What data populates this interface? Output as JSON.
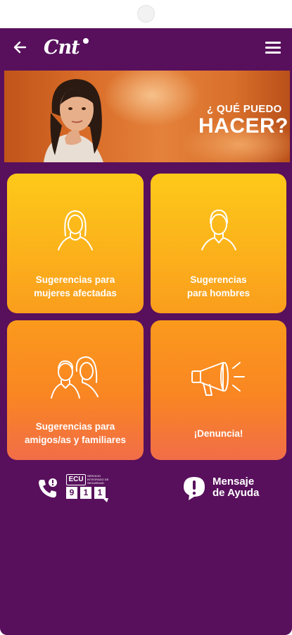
{
  "header": {
    "logo_text": "Cnt",
    "back_icon": "arrow-left-icon",
    "menu_icon": "hamburger-menu-icon"
  },
  "banner": {
    "question_line1": "¿ QUÉ PUEDO",
    "question_line2": "HACER?"
  },
  "cards": [
    {
      "line1": "Sugerencias para",
      "line2": "mujeres afectadas",
      "icon": "woman-icon"
    },
    {
      "line1": "Sugerencias",
      "line2": "para hombres",
      "icon": "man-icon"
    },
    {
      "line1": "Sugerencias para",
      "line2": "amigos/as y familiares",
      "icon": "group-people-icon"
    },
    {
      "line1": "¡Denuncia!",
      "icon": "megaphone-icon"
    }
  ],
  "bottom": {
    "emergency": {
      "ecu_label": "ECU",
      "digits": [
        "9",
        "1",
        "1"
      ],
      "icon": "phone-alert-icon",
      "small_text": "SERVICIO INTEGRADO DE SEGURIDAD"
    },
    "help": {
      "line1": "Mensaje",
      "line2": "de Ayuda",
      "icon": "alert-bubble-icon"
    }
  },
  "colors": {
    "background": "#58105c",
    "card_yellow": "#fcb21b",
    "card_orange": "#f98523",
    "text": "#ffffff"
  }
}
